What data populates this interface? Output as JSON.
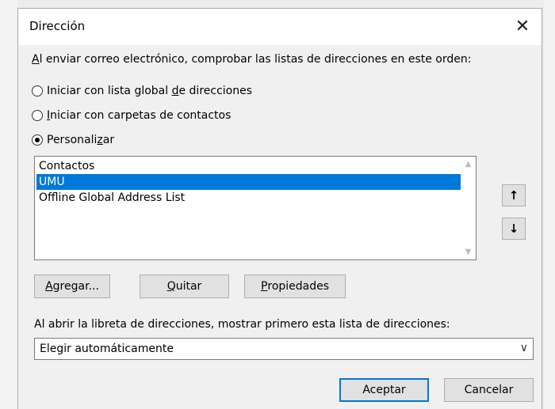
{
  "window": {
    "title": "Dirección"
  },
  "heading": {
    "pre": "",
    "underline": "A",
    "post": "l enviar correo electrónico, comprobar las listas de direcciones en este orden:"
  },
  "radios": [
    {
      "pre": "Iniciar con lista global ",
      "underline": "d",
      "post": "e direcciones",
      "selected": false
    },
    {
      "pre": "",
      "underline": "I",
      "post": "niciar con carpetas de contactos",
      "selected": false
    },
    {
      "pre": "Personali",
      "underline": "z",
      "post": "ar",
      "selected": true
    }
  ],
  "address_list": {
    "items": [
      {
        "label": "Contactos",
        "selected": false
      },
      {
        "label": "UMU",
        "selected": true
      },
      {
        "label": "Offline Global Address List",
        "selected": false
      }
    ]
  },
  "move_buttons": {
    "up_glyph": "↑",
    "down_glyph": "↓"
  },
  "buttons": {
    "add": {
      "underline": "A",
      "post": "gregar..."
    },
    "remove": {
      "underline": "Q",
      "post": "uitar"
    },
    "properties": {
      "underline": "P",
      "post": "ropiedades"
    }
  },
  "open_label": "Al abrir la libreta de direcciones, mostrar primero esta lista de direcciones:",
  "combo": {
    "value": "Elegir automáticamente"
  },
  "footer": {
    "ok": "Aceptar",
    "cancel": "Cancelar"
  },
  "colors": {
    "accent": "#0078d7",
    "dialog_bg": "#f0f0f0",
    "button_bg": "#e1e1e1"
  }
}
